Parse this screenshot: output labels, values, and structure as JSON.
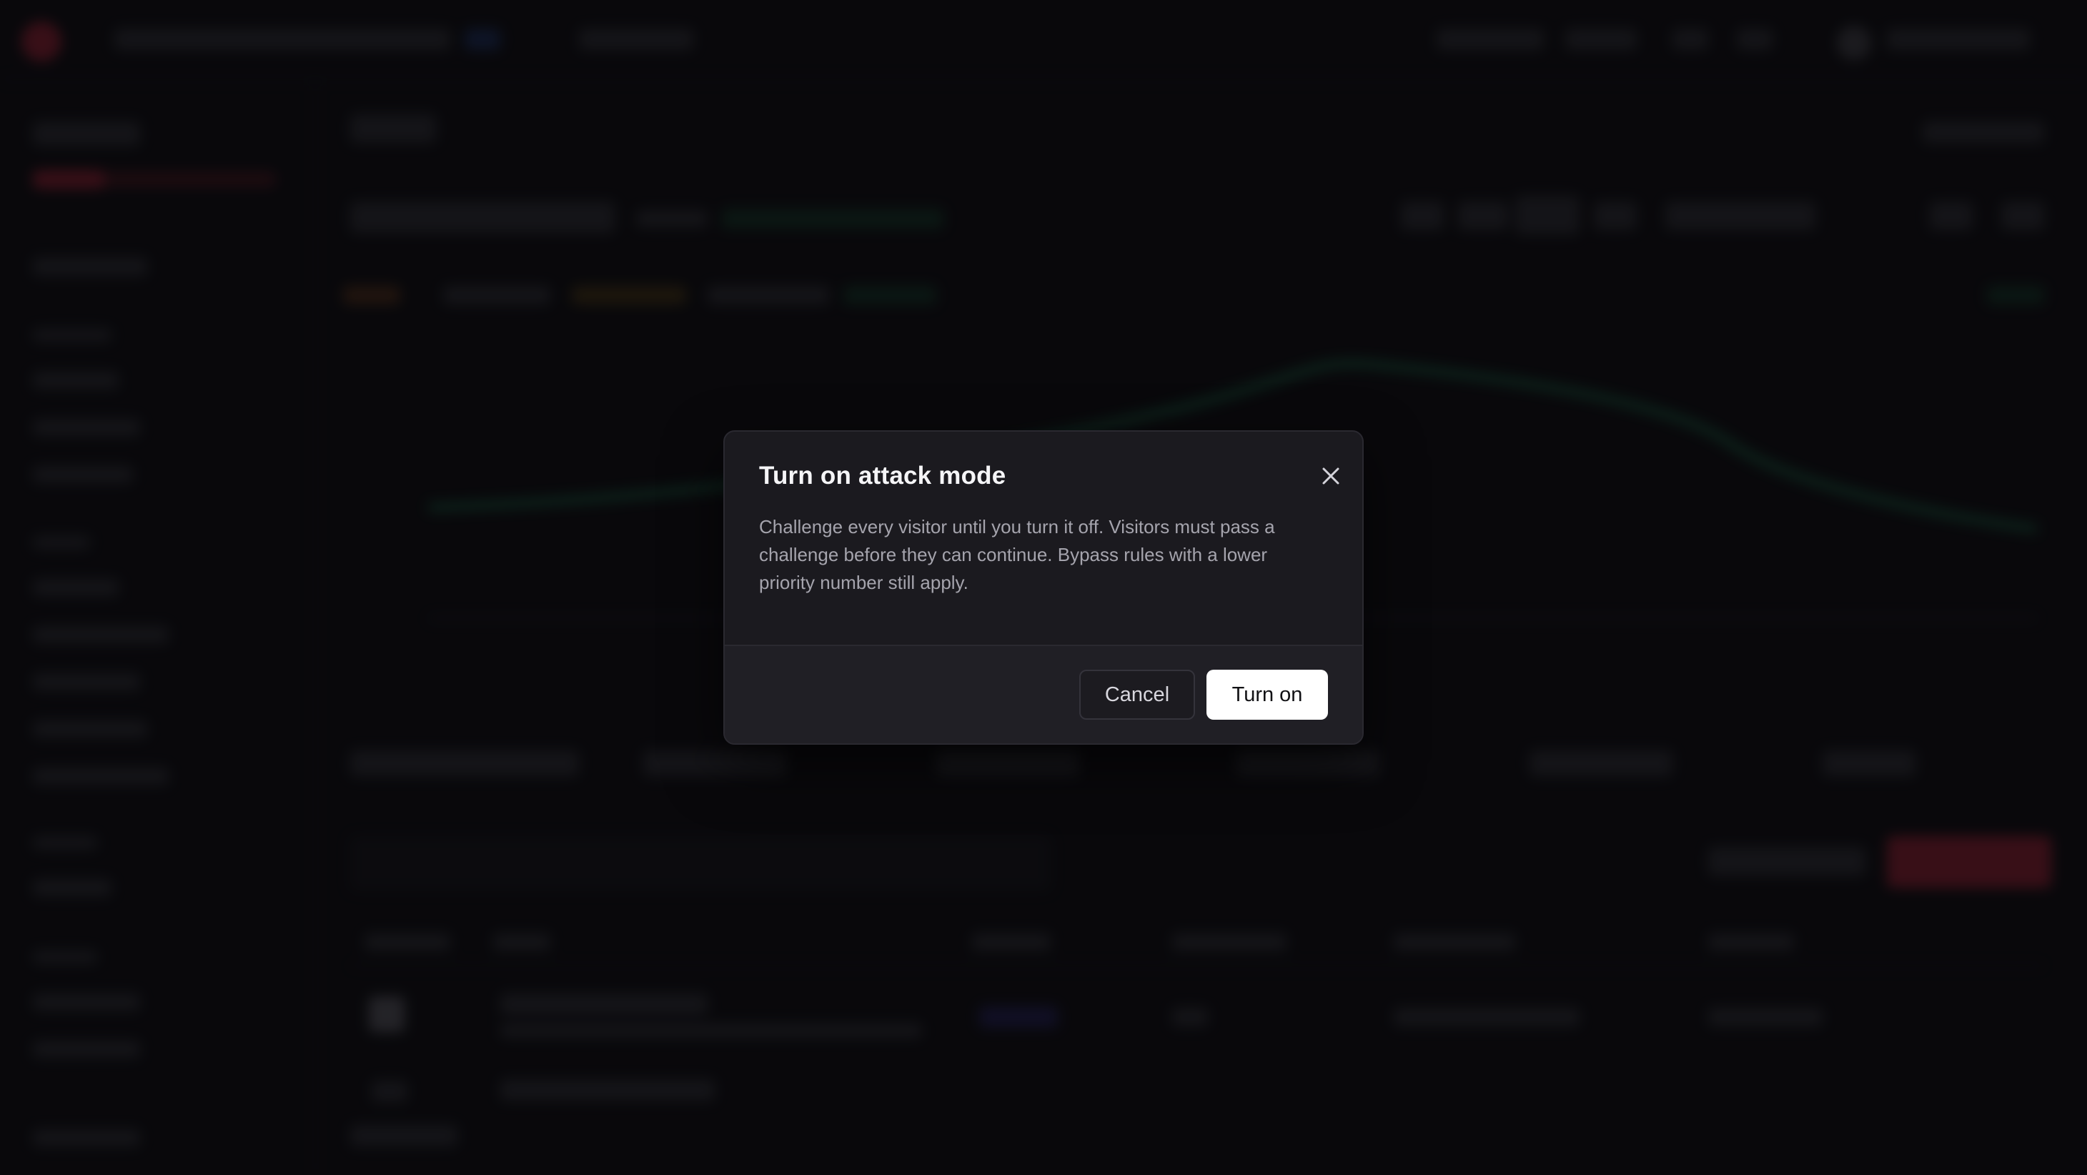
{
  "modal": {
    "title": "Turn on attack mode",
    "body": "Challenge every visitor until you turn it off. Visitors must pass a challenge before they can continue. Bypass rules with a lower priority number still apply.",
    "cancel_label": "Cancel",
    "confirm_label": "Turn on",
    "close_icon": "close-icon"
  },
  "colors": {
    "overlay": "#08080a",
    "modal_bg": "#1b1a1f",
    "footer_bg": "#201f25",
    "confirm_bg": "#ffffff",
    "brand_red": "#e0324e",
    "chart_green": "#1f8a5b"
  }
}
